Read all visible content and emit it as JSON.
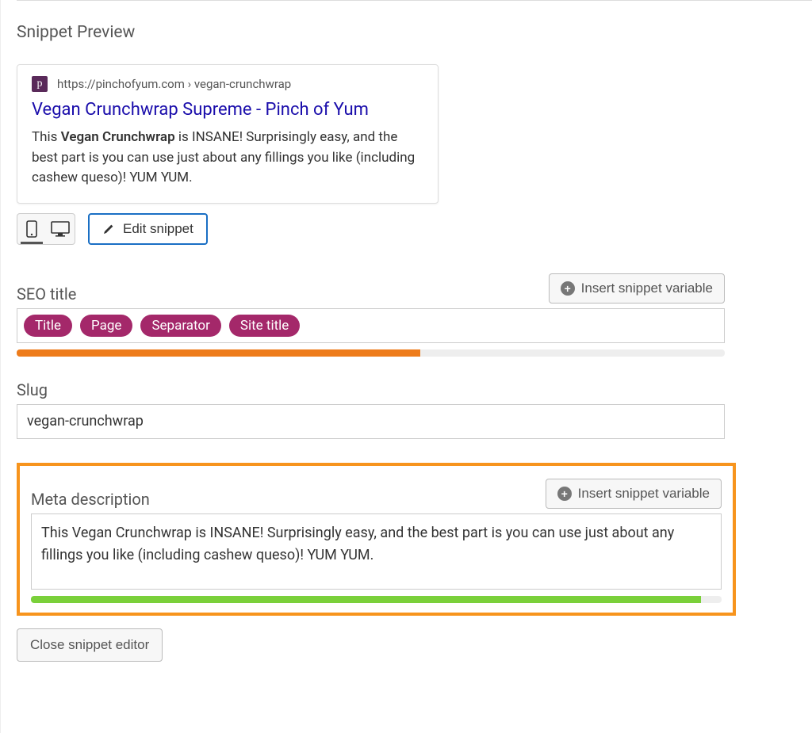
{
  "heading": "Snippet Preview",
  "preview": {
    "favicon_letter": "p",
    "url": "https://pinchofyum.com › vegan-crunchwrap",
    "title": "Vegan Crunchwrap Supreme - Pinch of Yum",
    "desc_prefix": "This ",
    "desc_bold": "Vegan Crunchwrap",
    "desc_suffix": " is INSANE! Surprisingly easy, and the best part is you can use just about any fillings you like (including cashew queso)! YUM YUM."
  },
  "edit_button": "Edit snippet",
  "insert_variable_label": "Insert snippet variable",
  "seo_title": {
    "label": "SEO title",
    "pills": [
      "Title",
      "Page",
      "Separator",
      "Site title"
    ],
    "progress_pct": 57
  },
  "slug": {
    "label": "Slug",
    "value": "vegan-crunchwrap"
  },
  "meta": {
    "label": "Meta description",
    "value": "This Vegan Crunchwrap is INSANE! Surprisingly easy, and the best part is you can use just about any fillings you like (including cashew queso)! YUM YUM.",
    "progress_pct": 97
  },
  "close_button": "Close snippet editor"
}
